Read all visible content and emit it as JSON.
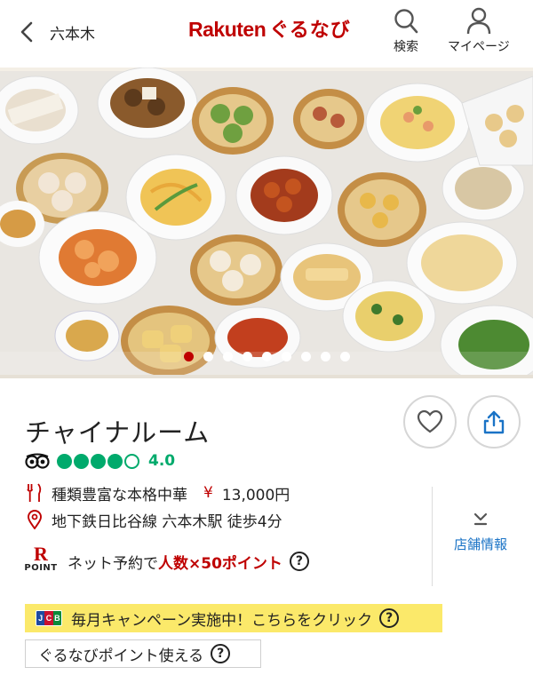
{
  "header": {
    "area": "六本木",
    "logo_rakuten": "Rakuten",
    "logo_gurunavi": "ぐるなび",
    "search_label": "検索",
    "mypage_label": "マイページ"
  },
  "carousel": {
    "slide_count": 9,
    "active_index": 0
  },
  "restaurant": {
    "name": "チャイナルーム",
    "rating": "4.0",
    "rating_bubbles": 4,
    "cuisine": "種類豊富な本格中華",
    "price_symbol": "¥",
    "price": "13,000円",
    "access": "地下鉄日比谷線 六本木駅 徒歩4分",
    "store_info_label": "店舗情報"
  },
  "points": {
    "badge_letter": "R",
    "badge_text": "POINT",
    "reserve_prefix": "ネット予約で",
    "reserve_highlight": "人数×50ポイント"
  },
  "banner": {
    "jcb": [
      "J",
      "C",
      "B"
    ],
    "text": "毎月キャンペーン実施中！こちらをクリック"
  },
  "gurunavi_points": {
    "label": "ぐるなびポイント使える"
  },
  "colors": {
    "brand": "#bf0000",
    "rating": "#00aa6c",
    "link": "#1a73c6",
    "banner": "#fbe96a"
  }
}
